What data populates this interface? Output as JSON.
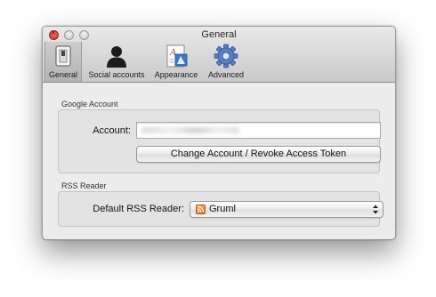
{
  "window": {
    "title": "General",
    "controls": [
      "close",
      "minimize",
      "zoom"
    ]
  },
  "toolbar": {
    "items": [
      {
        "label": "General",
        "icon": "switch-icon",
        "selected": true
      },
      {
        "label": "Social accounts",
        "icon": "person-silhouette-icon",
        "selected": false
      },
      {
        "label": "Appearance",
        "icon": "font-document-icon",
        "selected": false
      },
      {
        "label": "Advanced",
        "icon": "gear-icon",
        "selected": false
      }
    ]
  },
  "google": {
    "section_title": "Google Account",
    "account_label": "Account:",
    "account_value": "",
    "change_button": "Change Account / Revoke Access Token"
  },
  "rss": {
    "section_title": "RSS Reader",
    "default_label": "Default RSS Reader:",
    "selected_value": "Gruml",
    "selected_icon": "rss-feed-icon"
  },
  "colors": {
    "close_button": "#d8362a",
    "window_background": "#ececec",
    "group_background": "#e3e3e3",
    "rss_icon": "#ef8b32",
    "gear_icon": "#4a6fb5"
  }
}
